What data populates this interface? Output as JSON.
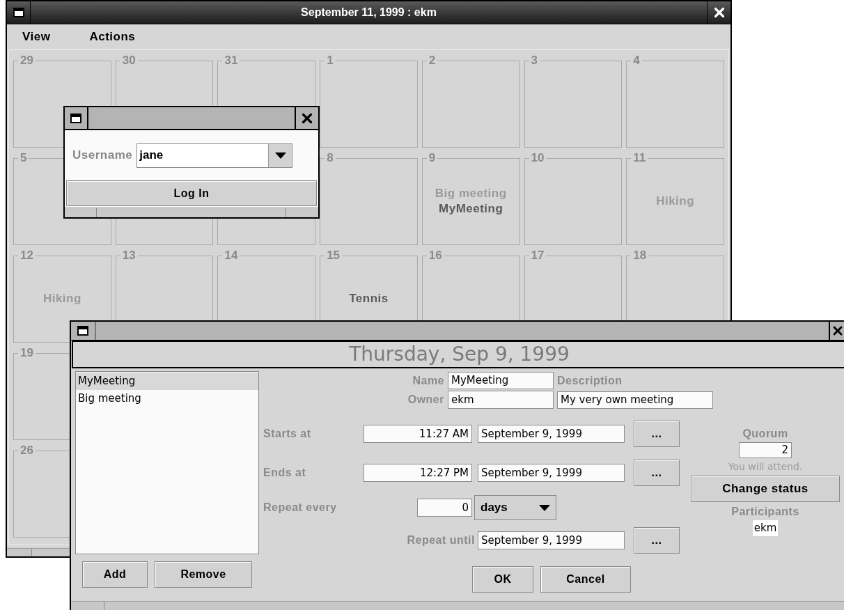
{
  "main_window": {
    "title": "September 11, 1999 : ekm",
    "menu": [
      "View",
      "Actions"
    ],
    "calendar": {
      "weeks": [
        [
          {
            "kind": "day",
            "day": "29"
          },
          {
            "kind": "day",
            "day": "30"
          },
          {
            "kind": "day",
            "day": "31"
          },
          {
            "kind": "day",
            "day": "1"
          },
          {
            "kind": "day",
            "day": "2"
          },
          {
            "kind": "day",
            "day": "3"
          },
          {
            "kind": "day",
            "day": "4"
          }
        ],
        [
          {
            "kind": "day",
            "day": "5"
          },
          {
            "kind": "covered"
          },
          {
            "kind": "covered"
          },
          {
            "kind": "day",
            "day": "8"
          },
          {
            "kind": "day",
            "day": "9",
            "events": [
              {
                "title": "Big meeting",
                "highlighted": false
              },
              {
                "title": "MyMeeting",
                "highlighted": true
              }
            ]
          },
          {
            "kind": "day",
            "day": "10"
          },
          {
            "kind": "day",
            "day": "11",
            "events": [
              {
                "title": "Hiking",
                "highlighted": false
              }
            ]
          }
        ],
        [
          {
            "kind": "day",
            "day": "12",
            "events": [
              {
                "title": "Hiking",
                "highlighted": false
              }
            ]
          },
          {
            "kind": "day",
            "day": "13"
          },
          {
            "kind": "day",
            "day": "14"
          },
          {
            "kind": "day",
            "day": "15",
            "events": [
              {
                "title": "Tennis",
                "highlighted": true
              }
            ]
          },
          {
            "kind": "day",
            "day": "16"
          },
          {
            "kind": "day",
            "day": "17"
          },
          {
            "kind": "day",
            "day": "18"
          }
        ],
        [
          {
            "kind": "day",
            "day": "19"
          }
        ],
        [
          {
            "kind": "day",
            "day": "26"
          }
        ]
      ]
    }
  },
  "login_dialog": {
    "username_label": "Username",
    "username": "jane",
    "button": "Log In"
  },
  "meeting_dialog": {
    "heading": "Thursday, Sep 9, 1999",
    "meetings": [
      {
        "label": "MyMeeting",
        "selected": true
      },
      {
        "label": "Big meeting",
        "selected": false
      }
    ],
    "list_buttons": [
      "Add",
      "Remove"
    ],
    "name_label": "Name",
    "name": "MyMeeting",
    "description_label": "Description",
    "owner_label": "Owner",
    "owner": "ekm",
    "description": "My very own meeting",
    "starts_label": "Starts at",
    "start_time": "11:27 AM",
    "start_date": "September 9, 1999",
    "start_picker": "...",
    "ends_label": "Ends at",
    "end_time": "12:27 PM",
    "end_date": "September 9, 1999",
    "end_picker": "...",
    "repeat_label": "Repeat every",
    "repeat_count": "0",
    "repeat_unit": "days",
    "until_label": "Repeat until",
    "until_date": "September 9, 1999",
    "until_picker": "...",
    "quorum_label": "Quorum",
    "quorum": "2",
    "attendance_note": "You will attend.",
    "change_status_button": "Change status",
    "participants_label": "Participants",
    "participants": [
      "ekm"
    ],
    "buttons": [
      "OK",
      "Cancel"
    ]
  }
}
